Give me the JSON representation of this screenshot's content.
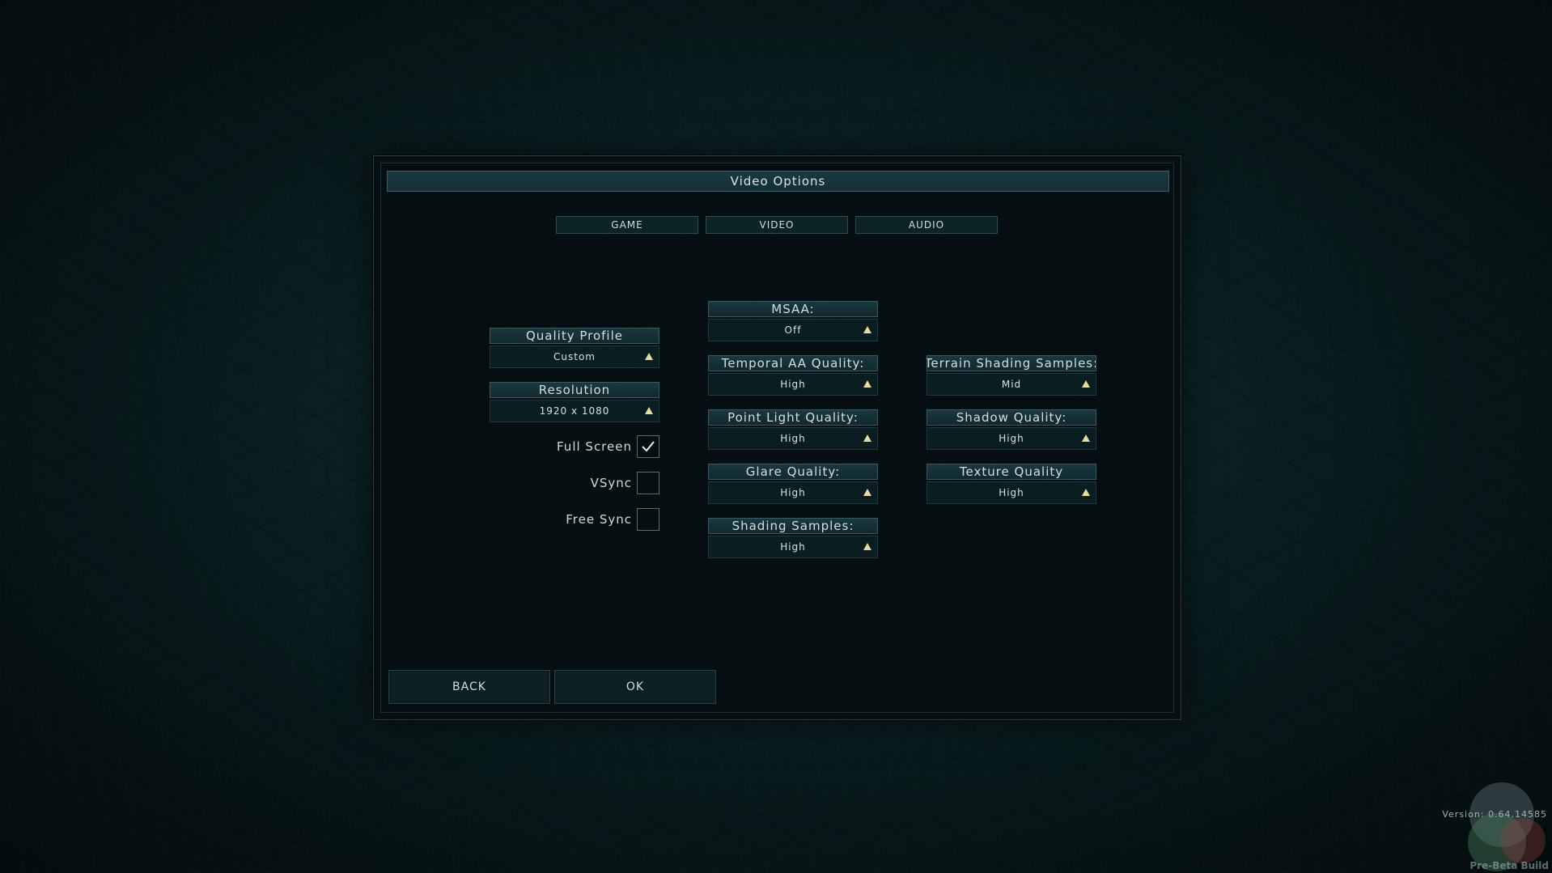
{
  "dialog": {
    "title": "Video Options"
  },
  "tabs": [
    {
      "label": "GAME"
    },
    {
      "label": "VIDEO"
    },
    {
      "label": "AUDIO"
    }
  ],
  "fields": {
    "quality_profile": {
      "label": "Quality Profile",
      "value": "Custom"
    },
    "resolution": {
      "label": "Resolution",
      "value": "1920 x 1080"
    },
    "msaa": {
      "label": "MSAA:",
      "value": "Off"
    },
    "temporal_aa": {
      "label": "Temporal AA Quality:",
      "value": "High"
    },
    "point_light": {
      "label": "Point Light Quality:",
      "value": "High"
    },
    "glare": {
      "label": "Glare Quality:",
      "value": "High"
    },
    "shading_samples": {
      "label": "Shading Samples:",
      "value": "High"
    },
    "terrain_shading": {
      "label": "Terrain Shading Samples:",
      "value": "Mid"
    },
    "shadow": {
      "label": "Shadow Quality:",
      "value": "High"
    },
    "texture": {
      "label": "Texture Quality",
      "value": "High"
    }
  },
  "checkboxes": {
    "full_screen": {
      "label": "Full Screen",
      "checked": true
    },
    "vsync": {
      "label": "VSync",
      "checked": false
    },
    "free_sync": {
      "label": "Free Sync",
      "checked": false
    }
  },
  "buttons": {
    "back": "BACK",
    "ok": "OK"
  },
  "footer": {
    "version": "Version: 0.64.14585",
    "build_label": "Pre-Beta Build"
  },
  "colors": {
    "accent_arrow": "#e8dc9c",
    "panel_bg": "#050e10",
    "title_bar": "#1a3a40"
  }
}
